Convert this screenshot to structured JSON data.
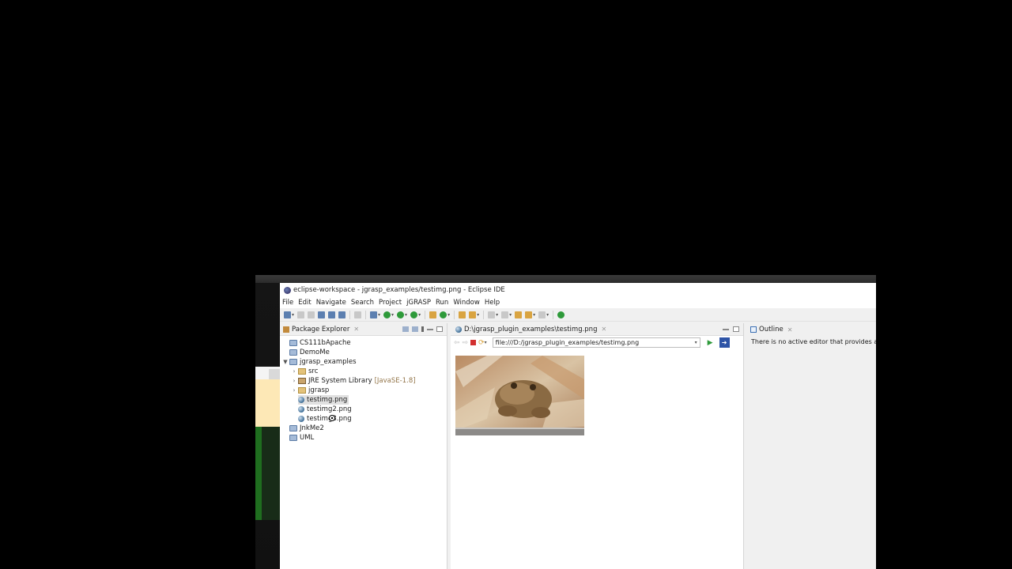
{
  "window": {
    "title": "eclipse-workspace - jgrasp_examples/testimg.png - Eclipse IDE"
  },
  "menu": [
    "File",
    "Edit",
    "Navigate",
    "Search",
    "Project",
    "jGRASP",
    "Run",
    "Window",
    "Help"
  ],
  "package_explorer": {
    "tab_label": "Package Explorer",
    "items": [
      {
        "label": "CS111bApache",
        "icon": "project-icon"
      },
      {
        "label": "DemoMe",
        "icon": "project-icon"
      },
      {
        "label": "jgrasp_examples",
        "icon": "project-icon",
        "expanded": true
      },
      {
        "label": "src",
        "icon": "folder-icon"
      },
      {
        "label": "JRE System Library",
        "suffix": "[JavaSE-1.8]",
        "icon": "library-icon"
      },
      {
        "label": "jgrasp",
        "icon": "folder-icon"
      },
      {
        "label": "testimg.png",
        "icon": "image-file-icon",
        "selected": true
      },
      {
        "label": "testimg2.png",
        "icon": "image-file-icon"
      },
      {
        "label": "testimg3.png",
        "icon": "image-file-icon"
      },
      {
        "label": "JnkMe2",
        "icon": "project-icon"
      },
      {
        "label": "UML",
        "icon": "project-icon"
      }
    ]
  },
  "editor": {
    "tab_label": "D:\\jgrasp_plugin_examples\\testimg.png",
    "url": "file:///D:/jgrasp_plugin_examples/testimg.png",
    "image_subject": "frog"
  },
  "outline": {
    "tab_label": "Outline",
    "message": "There is no active editor that provides an ou"
  }
}
